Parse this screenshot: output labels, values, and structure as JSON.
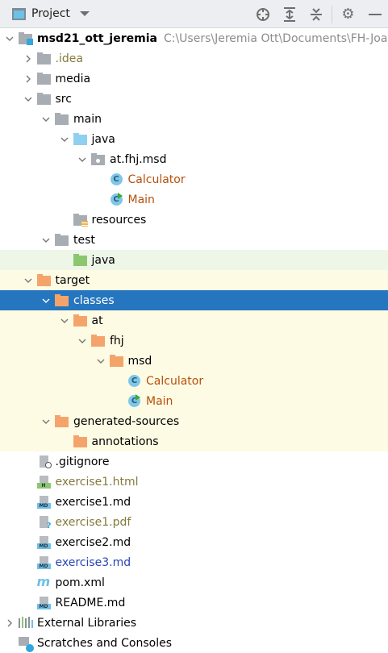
{
  "header": {
    "title": "Project",
    "tools": [
      "locate-icon",
      "expand-all-icon",
      "collapse-all-icon",
      "gear-icon",
      "minimize-icon"
    ]
  },
  "colors": {
    "selection": "#2675bf",
    "excluded_bg": "#fdfbe3",
    "test_bg": "#eef6e8",
    "modified": "#b5500b",
    "untracked": "#857a3b",
    "changed": "#2846b8"
  },
  "tree": [
    {
      "label": "msd21_ott_jeremia",
      "path": "C:\\Users\\Jeremia Ott\\Documents\\FH-Joan_(",
      "depth": 0,
      "chev": "down",
      "icon": "module",
      "bold": true
    },
    {
      "label": ".idea",
      "depth": 1,
      "chev": "right",
      "icon": "folder-grey",
      "color": "olive"
    },
    {
      "label": "media",
      "depth": 1,
      "chev": "right",
      "icon": "folder-grey"
    },
    {
      "label": "src",
      "depth": 1,
      "chev": "down",
      "icon": "folder-grey"
    },
    {
      "label": "main",
      "depth": 2,
      "chev": "down",
      "icon": "folder-grey"
    },
    {
      "label": "java",
      "depth": 3,
      "chev": "down",
      "icon": "folder-blue"
    },
    {
      "label": "at.fhj.msd",
      "depth": 4,
      "chev": "down",
      "icon": "package"
    },
    {
      "label": "Calculator",
      "depth": 5,
      "icon": "class",
      "color": "mod"
    },
    {
      "label": "Main",
      "depth": 5,
      "icon": "class-run",
      "color": "mod"
    },
    {
      "label": "resources",
      "depth": 3,
      "icon": "resources"
    },
    {
      "label": "test",
      "depth": 2,
      "chev": "down",
      "icon": "folder-grey"
    },
    {
      "label": "java",
      "depth": 3,
      "icon": "folder-green",
      "bg": "green"
    },
    {
      "label": "target",
      "depth": 1,
      "chev": "down",
      "icon": "folder-orange",
      "bg": "yellow"
    },
    {
      "label": "classes",
      "depth": 2,
      "chev": "down",
      "icon": "folder-orange",
      "bg": "sel"
    },
    {
      "label": "at",
      "depth": 3,
      "chev": "down",
      "icon": "folder-orange",
      "bg": "yellow"
    },
    {
      "label": "fhj",
      "depth": 4,
      "chev": "down",
      "icon": "folder-orange",
      "bg": "yellow"
    },
    {
      "label": "msd",
      "depth": 5,
      "chev": "down",
      "icon": "folder-orange",
      "bg": "yellow"
    },
    {
      "label": "Calculator",
      "depth": 6,
      "icon": "class",
      "color": "mod",
      "bg": "yellow"
    },
    {
      "label": "Main",
      "depth": 6,
      "icon": "class-run",
      "color": "mod",
      "bg": "yellow"
    },
    {
      "label": "generated-sources",
      "depth": 2,
      "chev": "down",
      "icon": "folder-orange",
      "bg": "yellow"
    },
    {
      "label": "annotations",
      "depth": 3,
      "icon": "folder-orange",
      "bg": "yellow"
    },
    {
      "label": ".gitignore",
      "depth": 1,
      "icon": "file-ignore"
    },
    {
      "label": "exercise1.html",
      "depth": 1,
      "icon": "file-html",
      "color": "olive"
    },
    {
      "label": "exercise1.md",
      "depth": 1,
      "icon": "file-md"
    },
    {
      "label": "exercise1.pdf",
      "depth": 1,
      "icon": "file-unknown",
      "color": "olive"
    },
    {
      "label": "exercise2.md",
      "depth": 1,
      "icon": "file-md"
    },
    {
      "label": "exercise3.md",
      "depth": 1,
      "icon": "file-md",
      "color": "blue"
    },
    {
      "label": "pom.xml",
      "depth": 1,
      "icon": "maven"
    },
    {
      "label": "README.md",
      "depth": 1,
      "icon": "file-md"
    },
    {
      "label": "External Libraries",
      "depth": 0,
      "chev": "right",
      "icon": "libraries"
    },
    {
      "label": "Scratches and Consoles",
      "depth": 0,
      "icon": "scratches"
    }
  ]
}
